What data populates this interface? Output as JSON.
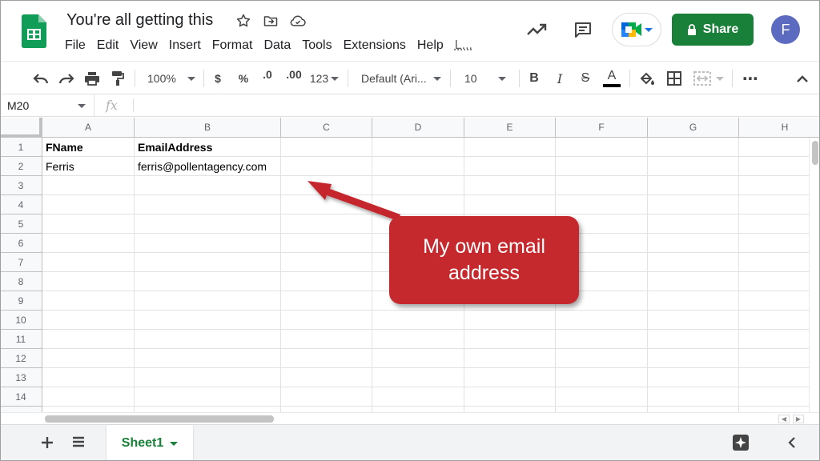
{
  "app": {
    "doc_title": "You're all getting this",
    "menu": [
      "File",
      "Edit",
      "View",
      "Insert",
      "Format",
      "Data",
      "Tools",
      "Extensions",
      "Help",
      "L..."
    ],
    "share_label": "Share",
    "avatar_initial": "F",
    "icons": [
      "sheets-logo-icon",
      "star-icon",
      "move-folder-icon",
      "cloud-status-icon",
      "trending-icon",
      "comment-icon",
      "meet-icon",
      "lock-icon"
    ]
  },
  "toolbar": {
    "zoom": "100%",
    "currency": "$",
    "percent": "%",
    "dec_decrease": ".0",
    "dec_increase": ".00",
    "number_format": "123",
    "font": "Default (Ari...",
    "font_size": "10",
    "bold": "B",
    "italic": "I",
    "strike": "S",
    "text_color": "A",
    "more": "⋯"
  },
  "formula_bar": {
    "name_box": "M20",
    "fx": "fx"
  },
  "sheet": {
    "columns": [
      "A",
      "B",
      "C",
      "D",
      "E",
      "F",
      "G",
      "H"
    ],
    "rows": [
      "1",
      "2",
      "3",
      "4",
      "5",
      "6",
      "7",
      "8",
      "9",
      "10",
      "11",
      "12",
      "13",
      "14"
    ],
    "cells": {
      "a1": "FName",
      "b1": "EmailAddress",
      "a2": "Ferris",
      "b2": "ferris@pollentagency.com"
    }
  },
  "tabs": {
    "active_sheet": "Sheet1"
  },
  "callout": {
    "text": "My own email address"
  },
  "colors": {
    "share_green": "#188038",
    "callout_red": "#c5282d",
    "avatar": "#5c6bc0"
  }
}
